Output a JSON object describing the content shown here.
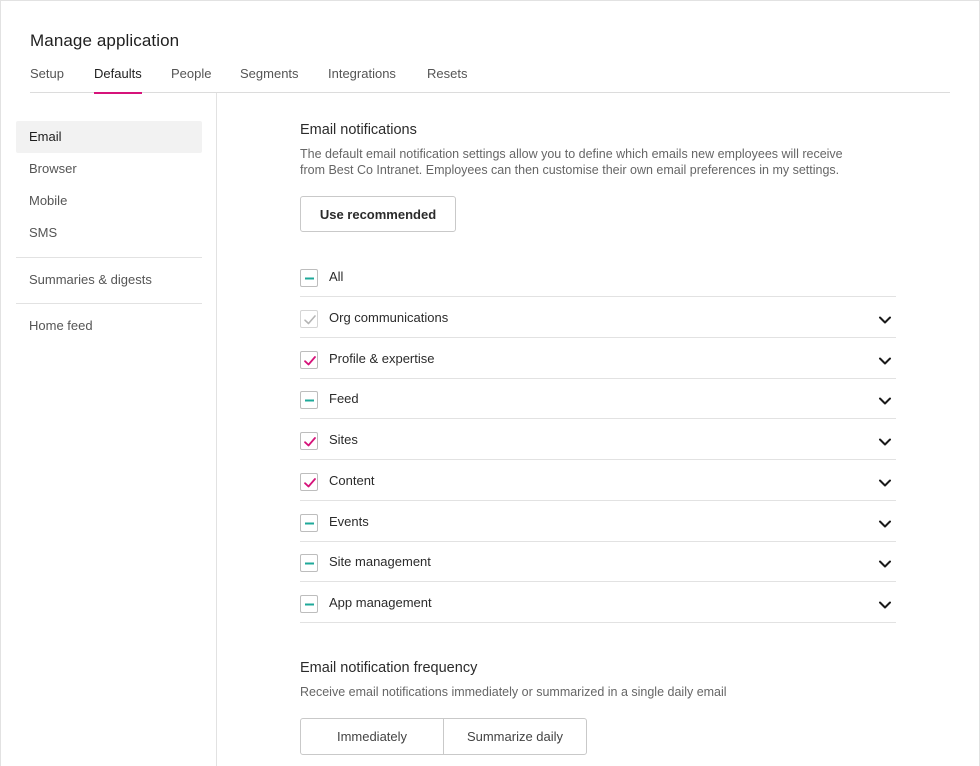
{
  "header": {
    "title": "Manage application"
  },
  "tabs": [
    {
      "label": "Setup"
    },
    {
      "label": "Defaults",
      "active": true
    },
    {
      "label": "People"
    },
    {
      "label": "Segments"
    },
    {
      "label": "Integrations"
    },
    {
      "label": "Resets"
    }
  ],
  "sidebar": {
    "items": [
      {
        "label": "Email",
        "active": true
      },
      {
        "label": "Browser"
      },
      {
        "label": "Mobile"
      },
      {
        "label": "SMS"
      },
      {
        "label": "Summaries & digests"
      },
      {
        "label": "Home feed"
      }
    ]
  },
  "email_notifications": {
    "title": "Email notifications",
    "description_line1": "The default email notification settings allow you to define which emails new employees will receive",
    "description_line2": "from Best Co Intranet. Employees can then customise their own email preferences in my settings.",
    "use_recommended_label": "Use recommended",
    "all_label": "All",
    "all_state": "indeterminate",
    "categories": [
      {
        "label": "Org communications",
        "state": "checked-disabled"
      },
      {
        "label": "Profile & expertise",
        "state": "checked"
      },
      {
        "label": "Feed",
        "state": "indeterminate"
      },
      {
        "label": "Sites",
        "state": "checked"
      },
      {
        "label": "Content",
        "state": "checked"
      },
      {
        "label": "Events",
        "state": "indeterminate"
      },
      {
        "label": "Site management",
        "state": "indeterminate"
      },
      {
        "label": "App management",
        "state": "indeterminate"
      }
    ]
  },
  "frequency": {
    "title": "Email notification frequency",
    "description": "Receive email notifications immediately or summarized in a single daily email",
    "options": [
      {
        "label": "Immediately"
      },
      {
        "label": "Summarize daily"
      }
    ]
  },
  "colors": {
    "accent": "#d6137a",
    "indeterminate": "#1fa99a",
    "disabled_check": "#b5b5b5"
  }
}
